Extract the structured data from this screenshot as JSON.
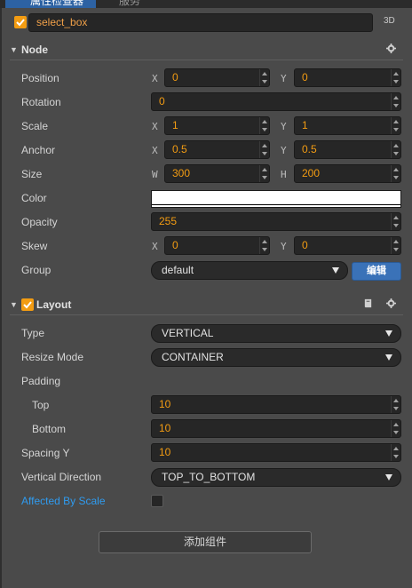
{
  "tabs": {
    "active": "属性检查器",
    "inactive": "服务"
  },
  "node": {
    "name": "select_box",
    "enabled": true,
    "badge_3d": "3D"
  },
  "node_section": {
    "title": "Node",
    "properties": {
      "position": {
        "label": "Position",
        "x_axis": "X",
        "x": "0",
        "y_axis": "Y",
        "y": "0"
      },
      "rotation": {
        "label": "Rotation",
        "value": "0"
      },
      "scale": {
        "label": "Scale",
        "x_axis": "X",
        "x": "1",
        "y_axis": "Y",
        "y": "1"
      },
      "anchor": {
        "label": "Anchor",
        "x_axis": "X",
        "x": "0.5",
        "y_axis": "Y",
        "y": "0.5"
      },
      "size": {
        "label": "Size",
        "w_axis": "W",
        "w": "300",
        "h_axis": "H",
        "h": "200"
      },
      "color": {
        "label": "Color",
        "value": "#ffffff"
      },
      "opacity": {
        "label": "Opacity",
        "value": "255"
      },
      "skew": {
        "label": "Skew",
        "x_axis": "X",
        "x": "0",
        "y_axis": "Y",
        "y": "0"
      },
      "group": {
        "label": "Group",
        "value": "default",
        "edit_label": "编辑"
      }
    }
  },
  "layout_section": {
    "title": "Layout",
    "enabled": true,
    "properties": {
      "type": {
        "label": "Type",
        "value": "VERTICAL"
      },
      "resize_mode": {
        "label": "Resize Mode",
        "value": "CONTAINER"
      },
      "padding": {
        "label": "Padding"
      },
      "padding_top": {
        "label": "Top",
        "value": "10"
      },
      "padding_bottom": {
        "label": "Bottom",
        "value": "10"
      },
      "spacing_y": {
        "label": "Spacing Y",
        "value": "10"
      },
      "vertical_direction": {
        "label": "Vertical Direction",
        "value": "TOP_TO_BOTTOM"
      },
      "affected_by_scale": {
        "label": "Affected By Scale",
        "checked": false
      }
    }
  },
  "add_component_label": "添加组件",
  "colors": {
    "panel_bg": "#4a4a4a",
    "field_bg": "#262626",
    "value_text": "#f39c12",
    "checkbox": "#f39c12",
    "accent_blue": "#3a72b8",
    "link_blue": "#2f9bef"
  }
}
